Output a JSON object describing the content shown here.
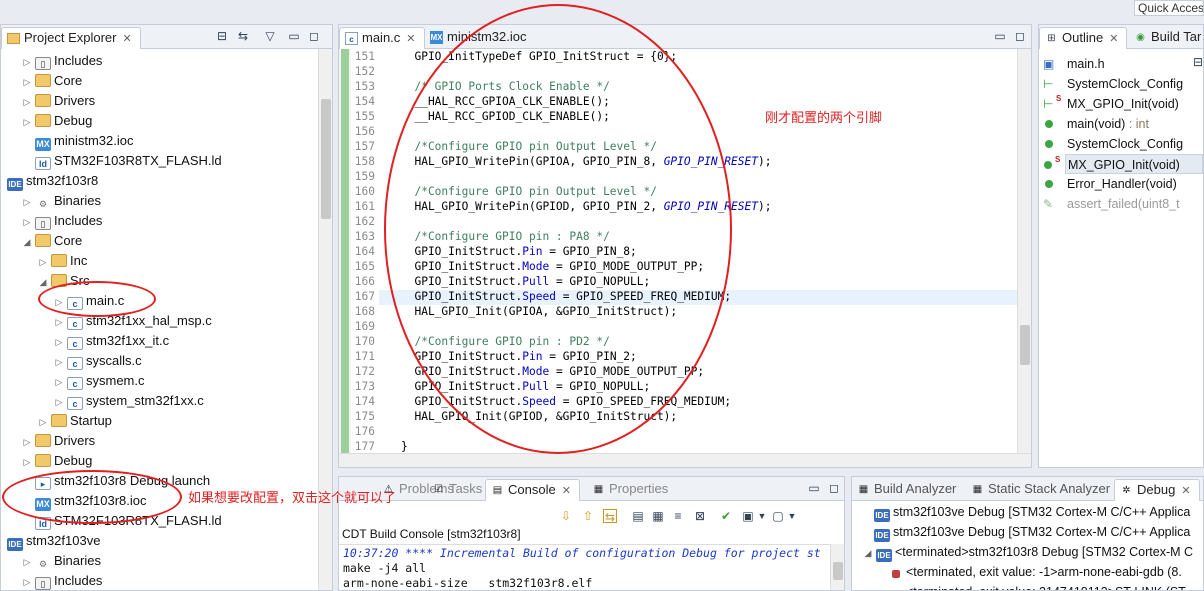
{
  "quick_access": "Quick Access",
  "explorer": {
    "tab_label": "Project Explorer",
    "items": [
      {
        "label": "Includes",
        "icon": "includes-icon",
        "indent": 1,
        "expanded": false
      },
      {
        "label": "Core",
        "icon": "folder-icon",
        "indent": 1,
        "expanded": false
      },
      {
        "label": "Drivers",
        "icon": "folder-icon",
        "indent": 1,
        "expanded": false
      },
      {
        "label": "Debug",
        "icon": "folder-icon",
        "indent": 1,
        "expanded": false
      },
      {
        "label": "ministm32.ioc",
        "icon": "mx-file-icon",
        "indent": 1,
        "expanded": null
      },
      {
        "label": "STM32F103R8TX_FLASH.ld",
        "icon": "ld-file-icon",
        "indent": 1,
        "expanded": null
      },
      {
        "label": "stm32f103r8",
        "icon": "ide-project-icon",
        "indent": 0,
        "expanded": true
      },
      {
        "label": "Binaries",
        "icon": "binaries-icon",
        "indent": 1,
        "expanded": false
      },
      {
        "label": "Includes",
        "icon": "includes-icon",
        "indent": 1,
        "expanded": false
      },
      {
        "label": "Core",
        "icon": "folder-icon",
        "indent": 1,
        "expanded": true
      },
      {
        "label": "Inc",
        "icon": "folder-icon",
        "indent": 2,
        "expanded": false
      },
      {
        "label": "Src",
        "icon": "folder-icon",
        "indent": 2,
        "expanded": true
      },
      {
        "label": "main.c",
        "icon": "c-file-icon",
        "indent": 3,
        "expanded": false
      },
      {
        "label": "stm32f1xx_hal_msp.c",
        "icon": "c-file-icon",
        "indent": 3,
        "expanded": false
      },
      {
        "label": "stm32f1xx_it.c",
        "icon": "c-file-icon",
        "indent": 3,
        "expanded": false
      },
      {
        "label": "syscalls.c",
        "icon": "c-file-icon",
        "indent": 3,
        "expanded": false
      },
      {
        "label": "sysmem.c",
        "icon": "c-file-icon",
        "indent": 3,
        "expanded": false
      },
      {
        "label": "system_stm32f1xx.c",
        "icon": "c-file-icon",
        "indent": 3,
        "expanded": false
      },
      {
        "label": "Startup",
        "icon": "folder-icon",
        "indent": 2,
        "expanded": false
      },
      {
        "label": "Drivers",
        "icon": "folder-icon",
        "indent": 1,
        "expanded": false
      },
      {
        "label": "Debug",
        "icon": "folder-icon",
        "indent": 1,
        "expanded": false
      },
      {
        "label": "stm32f103r8 Debug.launch",
        "icon": "launch-icon",
        "indent": 1,
        "expanded": null
      },
      {
        "label": "stm32f103r8.ioc",
        "icon": "mx-file-icon",
        "indent": 1,
        "expanded": null
      },
      {
        "label": "STM32F103R8TX_FLASH.ld",
        "icon": "ld-file-icon",
        "indent": 1,
        "expanded": null
      },
      {
        "label": "stm32f103ve",
        "icon": "ide-project-icon",
        "indent": 0,
        "expanded": true
      },
      {
        "label": "Binaries",
        "icon": "binaries-icon",
        "indent": 1,
        "expanded": false
      },
      {
        "label": "Includes",
        "icon": "includes-icon",
        "indent": 1,
        "expanded": false
      }
    ]
  },
  "editor": {
    "tabs": [
      {
        "label": "main.c",
        "active": true,
        "icon": "c-file-icon"
      },
      {
        "label": "ministm32.ioc",
        "active": false,
        "icon": "mx-file-icon"
      }
    ],
    "lines": [
      {
        "n": "151",
        "t": "  GPIO_InitTypeDef GPIO_InitStruct = {0};"
      },
      {
        "n": "152",
        "t": ""
      },
      {
        "n": "153",
        "t": "  /* GPIO Ports Clock Enable */"
      },
      {
        "n": "154",
        "t": "  __HAL_RCC_GPIOA_CLK_ENABLE();"
      },
      {
        "n": "155",
        "t": "  __HAL_RCC_GPIOD_CLK_ENABLE();"
      },
      {
        "n": "156",
        "t": ""
      },
      {
        "n": "157",
        "t": "  /*Configure GPIO pin Output Level */"
      },
      {
        "n": "158",
        "t": "  HAL_GPIO_WritePin(GPIOA, GPIO_PIN_8, GPIO_PIN_RESET);"
      },
      {
        "n": "159",
        "t": ""
      },
      {
        "n": "160",
        "t": "  /*Configure GPIO pin Output Level */"
      },
      {
        "n": "161",
        "t": "  HAL_GPIO_WritePin(GPIOD, GPIO_PIN_2, GPIO_PIN_RESET);"
      },
      {
        "n": "162",
        "t": ""
      },
      {
        "n": "163",
        "t": "  /*Configure GPIO pin : PA8 */"
      },
      {
        "n": "164",
        "t": "  GPIO_InitStruct.Pin = GPIO_PIN_8;"
      },
      {
        "n": "165",
        "t": "  GPIO_InitStruct.Mode = GPIO_MODE_OUTPUT_PP;"
      },
      {
        "n": "166",
        "t": "  GPIO_InitStruct.Pull = GPIO_NOPULL;"
      },
      {
        "n": "167",
        "t": "  GPIO_InitStruct.Speed = GPIO_SPEED_FREQ_MEDIUM;"
      },
      {
        "n": "168",
        "t": "  HAL_GPIO_Init(GPIOA, &GPIO_InitStruct);"
      },
      {
        "n": "169",
        "t": ""
      },
      {
        "n": "170",
        "t": "  /*Configure GPIO pin : PD2 */"
      },
      {
        "n": "171",
        "t": "  GPIO_InitStruct.Pin = GPIO_PIN_2;"
      },
      {
        "n": "172",
        "t": "  GPIO_InitStruct.Mode = GPIO_MODE_OUTPUT_PP;"
      },
      {
        "n": "173",
        "t": "  GPIO_InitStruct.Pull = GPIO_NOPULL;"
      },
      {
        "n": "174",
        "t": "  GPIO_InitStruct.Speed = GPIO_SPEED_FREQ_MEDIUM;"
      },
      {
        "n": "175",
        "t": "  HAL_GPIO_Init(GPIOD, &GPIO_InitStruct);"
      },
      {
        "n": "176",
        "t": ""
      },
      {
        "n": "177",
        "t": "}"
      }
    ]
  },
  "outline": {
    "tabs": [
      {
        "label": "Outline",
        "active": true
      },
      {
        "label": "Build Tar",
        "active": false
      }
    ],
    "items": [
      {
        "label": "main.h",
        "detail": "",
        "kind": "include"
      },
      {
        "label": "SystemClock_Config",
        "detail": "",
        "kind": "decl"
      },
      {
        "label": "MX_GPIO_Init(void)",
        "detail": "",
        "kind": "static-decl"
      },
      {
        "label": "main(void)",
        "detail": " : int",
        "kind": "function"
      },
      {
        "label": "SystemClock_Config",
        "detail": "",
        "kind": "function"
      },
      {
        "label": "MX_GPIO_Init(void)",
        "detail": "",
        "kind": "static-function"
      },
      {
        "label": "Error_Handler(void)",
        "detail": "",
        "kind": "function"
      },
      {
        "label": "assert_failed(uint8_t",
        "detail": "",
        "kind": "disabled"
      }
    ]
  },
  "console": {
    "tabs": [
      {
        "label": "Problems",
        "active": false
      },
      {
        "label": "Tasks",
        "active": false
      },
      {
        "label": "Console",
        "active": true
      },
      {
        "label": "Properties",
        "active": false
      }
    ],
    "title": "CDT Build Console [stm32f103r8]",
    "lines": [
      "10:37:20 **** Incremental Build of configuration Debug for project st",
      "make -j4 all",
      "arm-none-eabi-size   stm32f103r8.elf"
    ]
  },
  "debug": {
    "tabs": [
      {
        "label": "Build Analyzer",
        "active": false
      },
      {
        "label": "Static Stack Analyzer",
        "active": false
      },
      {
        "label": "Debug",
        "active": true
      }
    ],
    "items": [
      {
        "label": "stm32f103ve Debug [STM32 Cortex-M C/C++ Applica",
        "indent": 0
      },
      {
        "label": "stm32f103ve Debug [STM32 Cortex-M C/C++ Applica",
        "indent": 0
      },
      {
        "label": "<terminated>stm32f103r8 Debug [STM32 Cortex-M C",
        "indent": 0
      },
      {
        "label": "<terminated, exit value: -1>arm-none-eabi-gdb (8.",
        "indent": 1
      },
      {
        "label": "<terminated, exit value: 2147418113>ST-LINK (ST",
        "indent": 1
      }
    ]
  },
  "annotations": {
    "code_note": "刚才配置的两个引脚",
    "ioc_note": "如果想要改配置，双击这个就可以了"
  },
  "colors": {
    "annotation": "#e02020",
    "comment": "#3f7f5f",
    "field": "#0000c0",
    "accent": "#3a6ebc"
  }
}
